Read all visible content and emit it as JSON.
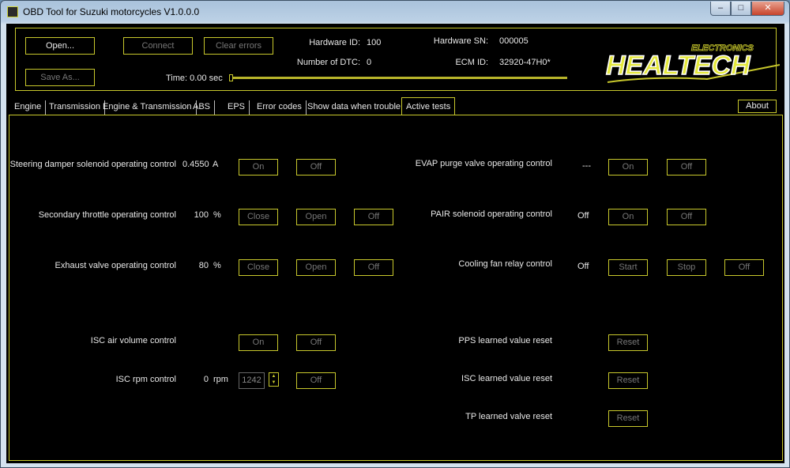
{
  "window": {
    "title": "OBD Tool for Suzuki motorcycles V1.0.0.0",
    "min_label": "‒",
    "max_label": "□",
    "close_label": "✕"
  },
  "header": {
    "open_label": "Open...",
    "connect_label": "Connect",
    "clear_errors_label": "Clear errors",
    "save_as_label": "Save As...",
    "time_label": "Time: 0.00 sec",
    "hw_id_label": "Hardware ID:",
    "hw_id_value": "100",
    "dtc_label": "Number of DTC:",
    "dtc_value": "0",
    "hw_sn_label": "Hardware SN:",
    "hw_sn_value": "000005",
    "ecm_label": "ECM ID:",
    "ecm_value": "32920-47H0*",
    "logo_main": "HEALTECH",
    "logo_sub": "ELECTRONICS",
    "progress_fraction": 0.0
  },
  "tabs": [
    {
      "label": "Engine"
    },
    {
      "label": "Transmission"
    },
    {
      "label": "Engine & Transmission"
    },
    {
      "label": "ABS"
    },
    {
      "label": "EPS"
    },
    {
      "label": "Error codes"
    },
    {
      "label": "Show data when trouble"
    },
    {
      "label": "Active tests"
    }
  ],
  "about_label": "About",
  "active_tests": {
    "steering": {
      "label": "Steering damper solenoid operating control",
      "value": "0.4550",
      "unit": "A",
      "on": "On",
      "off": "Off"
    },
    "secondary": {
      "label": "Secondary throttle operating control",
      "value": "100",
      "unit": "%",
      "close": "Close",
      "open": "Open",
      "off": "Off"
    },
    "exhaust": {
      "label": "Exhaust valve operating control",
      "value": "80",
      "unit": "%",
      "close": "Close",
      "open": "Open",
      "off": "Off"
    },
    "isc_air": {
      "label": "ISC air volume control",
      "on": "On",
      "off": "Off"
    },
    "isc_rpm": {
      "label": "ISC rpm control",
      "value": "0",
      "unit": "rpm",
      "input": "1242",
      "off": "Off"
    },
    "evap": {
      "label": "EVAP purge valve operating control",
      "value": "---",
      "on": "On",
      "off": "Off"
    },
    "pair": {
      "label": "PAIR solenoid operating control",
      "value": "Off",
      "on": "On",
      "off": "Off"
    },
    "fan": {
      "label": "Cooling fan relay control",
      "value": "Off",
      "start": "Start",
      "stop": "Stop",
      "off": "Off"
    },
    "pps": {
      "label": "PPS learned value reset",
      "reset": "Reset"
    },
    "isc_learn": {
      "label": "ISC learned value reset",
      "reset": "Reset"
    },
    "tp": {
      "label": "TP learned valve reset",
      "reset": "Reset"
    }
  }
}
